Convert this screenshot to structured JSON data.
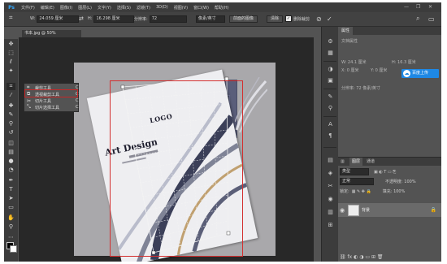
{
  "menu": {
    "logo": "Ps",
    "items": [
      "文件(F)",
      "编辑(E)",
      "图像(I)",
      "图层(L)",
      "文字(Y)",
      "选择(S)",
      "滤镜(T)",
      "3D(D)",
      "视图(V)",
      "窗口(W)",
      "帮助(H)"
    ],
    "min": "—",
    "restore": "❐",
    "close": "✕"
  },
  "options": {
    "w_label": "W:",
    "w_value": "24.059 厘米",
    "swap_icon": "⇄",
    "h_label": "H:",
    "h_value": "16.298 厘米",
    "res_label": "分辨率:",
    "res_value": "72",
    "unit_value": "像素/英寸",
    "front_image": "前面的图像",
    "clear": "清除",
    "delete_crop_label": "删除裁剪",
    "cancel_icon": "⊘",
    "commit_icon": "✓",
    "search_icon": "⌕",
    "workspace_icon": "▭"
  },
  "tab": {
    "label": "书本.jpg @ 50%(RGB/8#)",
    "close": "✕"
  },
  "flyout": {
    "items": [
      {
        "icon": "⌗",
        "label": "裁剪工具",
        "key": "C"
      },
      {
        "icon": "⧉",
        "label": "透视裁剪工具",
        "key": "C"
      },
      {
        "icon": "✂",
        "label": "切片工具",
        "key": "C"
      },
      {
        "icon": "⤡",
        "label": "切片选择工具",
        "key": "C"
      }
    ]
  },
  "cover": {
    "logo": "LOGO",
    "title": "Art Design"
  },
  "properties": {
    "tabs": [
      "属性"
    ],
    "doc_props": "文档属性",
    "w": "W: 24.1 厘米",
    "h": "H: 16.3 厘米",
    "x": "X: 0 厘米",
    "y": "Y: 0 厘米",
    "resolution": "分辨率: 72 像素/英寸",
    "upload_label": "百度上传"
  },
  "layers": {
    "tabs": [
      "图层",
      "通道"
    ],
    "kind": "类型",
    "blend": "正常",
    "opacity": "不透明度: 100%",
    "lock_label": "锁定:",
    "fill": "填充: 100%",
    "layer_name": "背景",
    "footer_icons": "⛓ fx ◐ ◑ ▭ ⊞ 🗑"
  }
}
